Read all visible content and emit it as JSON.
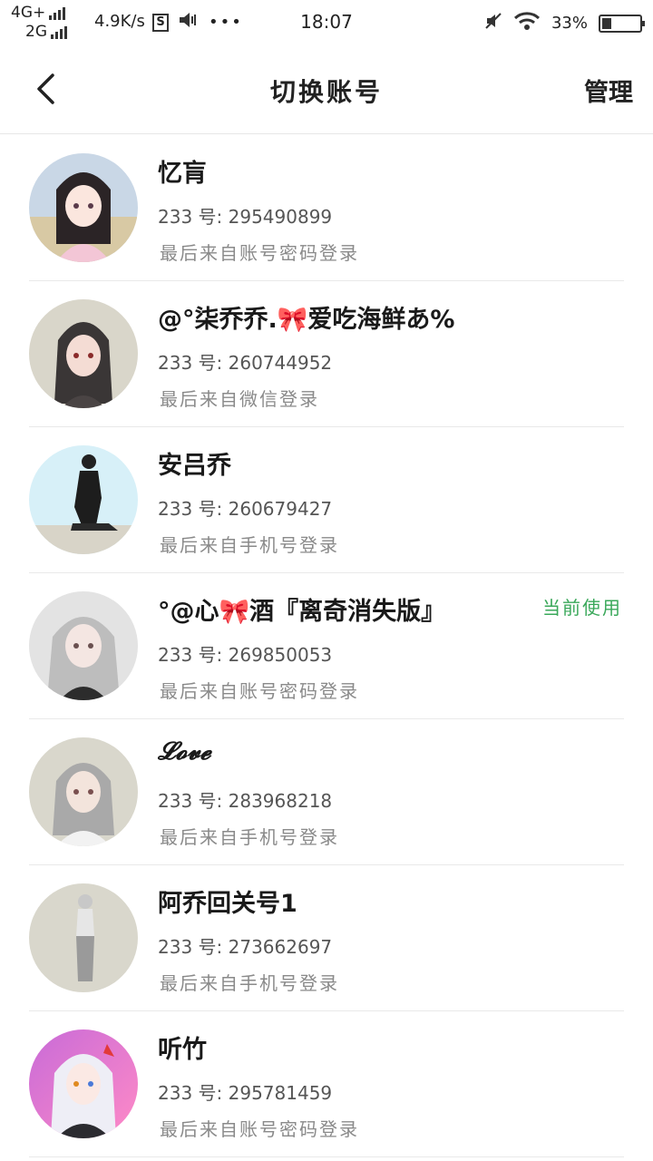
{
  "status_bar": {
    "network_top": "4G+",
    "network_bottom": "2G",
    "speed": "4.9K/s",
    "s_icon": "S",
    "volume_icon": "speaker-icon",
    "more_icon": "•••",
    "time": "18:07",
    "battery_percent": "33%",
    "battery_level": 0.33
  },
  "header": {
    "title": "切换账号",
    "manage": "管理"
  },
  "accounts": [
    {
      "name": "忆肓",
      "id": "233 号: 295490899",
      "login": "最后来自账号密码登录",
      "current": ""
    },
    {
      "name": "@°柒乔乔.🎀爱吃海鲜あ%",
      "id": "233 号: 260744952",
      "login": "最后来自微信登录",
      "current": ""
    },
    {
      "name": "安吕乔",
      "id": "233 号: 260679427",
      "login": "最后来自手机号登录",
      "current": ""
    },
    {
      "name": "°@心🎀酒『离奇消失版』",
      "id": "233 号: 269850053",
      "login": "最后来自账号密码登录",
      "current": "当前使用"
    },
    {
      "name": "𝓛𝓸𝓿𝓮",
      "id": "233 号: 283968218",
      "login": "最后来自手机号登录",
      "current": ""
    },
    {
      "name": "阿乔回关号1",
      "id": "233 号: 273662697",
      "login": "最后来自手机号登录",
      "current": ""
    },
    {
      "name": "听竹",
      "id": "233 号: 295781459",
      "login": "最后来自账号密码登录",
      "current": ""
    }
  ]
}
